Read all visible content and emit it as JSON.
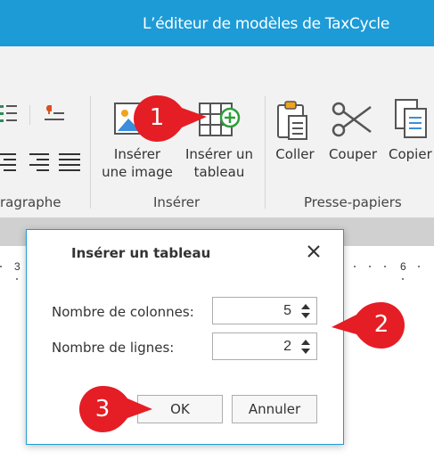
{
  "window": {
    "title": "L’éditeur de modèles de TaxCycle"
  },
  "ribbon": {
    "paragraph_group_label": "ragraphe",
    "insert_group": {
      "label": "Insérer",
      "insert_image_label_line1": "Insérer",
      "insert_image_label_line2": "une image",
      "insert_table_label_line1": "Insérer un",
      "insert_table_label_line2": "tableau"
    },
    "clipboard_group": {
      "label": "Presse-papiers",
      "paste_label": "Coller",
      "cut_label": "Couper",
      "copy_label": "Copier"
    }
  },
  "ruler": {
    "left_number": "3",
    "right_number": "6"
  },
  "dialog": {
    "title": "Insérer un tableau",
    "columns_label": "Nombre de colonnes:",
    "columns_value": "5",
    "rows_label": "Nombre de lignes:",
    "rows_value": "2",
    "ok_label": "OK",
    "cancel_label": "Annuler"
  },
  "callouts": {
    "step1": "1",
    "step2": "2",
    "step3": "3"
  },
  "colors": {
    "title_bar": "#1d9bd7",
    "callout": "#e41e24",
    "ribbon_bg": "#f2f2f2"
  }
}
